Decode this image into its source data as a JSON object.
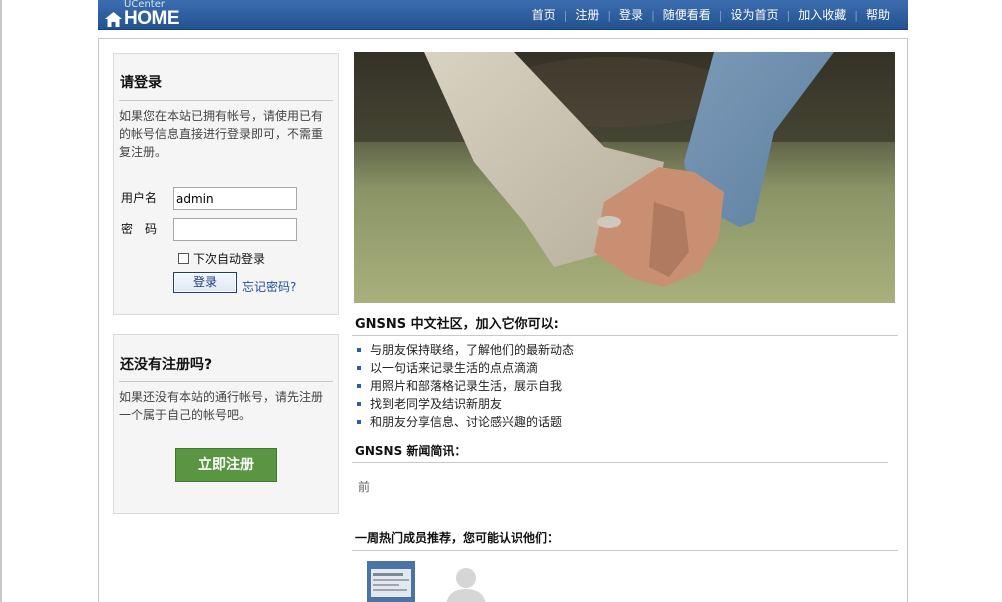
{
  "header": {
    "logo_top": "UCenter",
    "logo_main": "HOME",
    "nav": [
      "首页",
      "注册",
      "登录",
      "随便看看",
      "设为首页",
      "加入收藏",
      "帮助"
    ]
  },
  "login": {
    "title": "请登录",
    "description": "如果您在本站已拥有帐号，请使用已有的帐号信息直接进行登录即可，不需重复注册。",
    "username_label": "用户名",
    "username_value": "admin",
    "password_label": "密　码",
    "password_value": "",
    "remember_label": "下次自动登录",
    "remember_checked": false,
    "submit_label": "登录",
    "forgot_label": "忘记密码?"
  },
  "register": {
    "title": "还没有注册吗?",
    "description": "如果还没有本站的通行帐号，请先注册一个属于自己的帐号吧。",
    "button_label": "立即注册"
  },
  "intro": {
    "title": "GNSNS 中文社区，加入它你可以:",
    "features": [
      "与朋友保持联络，了解他们的最新动态",
      "以一句话来记录生活的点点滴滴",
      "用照片和部落格记录生活，展示自我",
      "找到老同学及结识新朋友",
      "和朋友分享信息、讨论感兴趣的话题"
    ]
  },
  "news": {
    "title": "GNSNS 新闻简讯：",
    "content": "前"
  },
  "members": {
    "title": "一周热门成员推荐，您可能认识他们："
  },
  "colors": {
    "header_top": "#3c6db0",
    "header_bottom": "#23528f",
    "register_button": "#5a9642",
    "link": "#1f4f9a"
  }
}
